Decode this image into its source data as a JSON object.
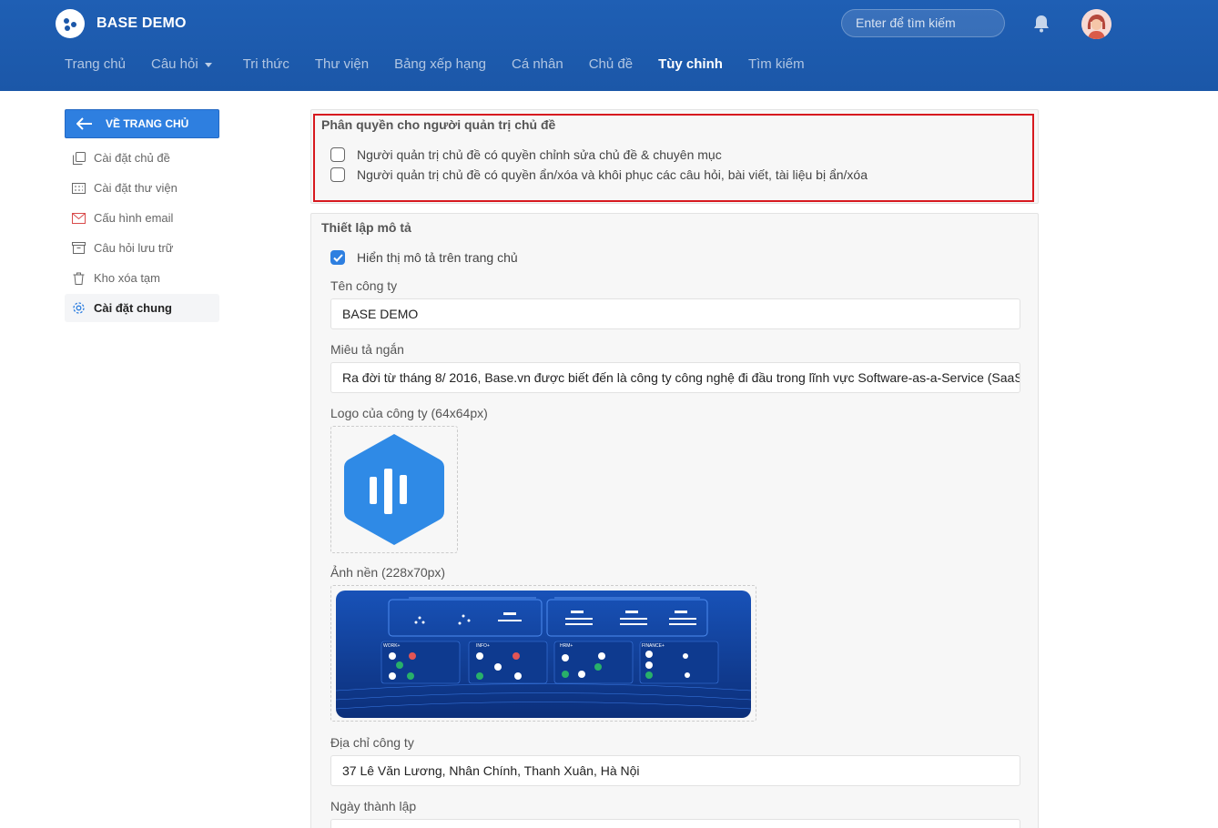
{
  "header": {
    "brand": "BASE DEMO",
    "search_placeholder": "Enter để tìm kiếm",
    "nav": [
      {
        "label": "Trang chủ"
      },
      {
        "label": "Câu hỏi"
      },
      {
        "label": "Tri thức"
      },
      {
        "label": "Thư viện"
      },
      {
        "label": "Bảng xếp hạng"
      },
      {
        "label": "Cá nhân"
      },
      {
        "label": "Chủ đề"
      },
      {
        "label": "Tùy chỉnh"
      },
      {
        "label": "Tìm kiếm"
      }
    ],
    "active_nav": "Tùy chỉnh"
  },
  "sidebar": {
    "back_label": "VỀ TRANG CHỦ",
    "items": [
      {
        "label": "Cài đặt chủ đề",
        "icon": "copy-icon"
      },
      {
        "label": "Cài đặt thư viện",
        "icon": "library-icon"
      },
      {
        "label": "Cấu hình email",
        "icon": "mail-icon"
      },
      {
        "label": "Câu hỏi lưu trữ",
        "icon": "archive-icon"
      },
      {
        "label": "Kho xóa tạm",
        "icon": "trash-icon"
      },
      {
        "label": "Cài đặt chung",
        "icon": "gear-icon"
      }
    ],
    "active_item": "Cài đặt chung"
  },
  "permissions": {
    "title": "Phân quyền cho người quản trị chủ đề",
    "options": [
      {
        "label": "Người quản trị chủ đề có quyền chỉnh sửa chủ đề & chuyên mục",
        "checked": false
      },
      {
        "label": "Người quản trị chủ đề có quyền ẩn/xóa và khôi phục các câu hỏi, bài viết, tài liệu bị ẩn/xóa",
        "checked": false
      }
    ]
  },
  "description": {
    "title": "Thiết lập mô tả",
    "show_on_home_label": "Hiển thị mô tả trên trang chủ",
    "show_on_home_checked": true,
    "company_name_label": "Tên công ty",
    "company_name_value": "BASE DEMO",
    "short_desc_label": "Miêu tả ngắn",
    "short_desc_value": "Ra đời từ tháng 8/ 2016, Base.vn được biết đến là công ty công nghệ đi đầu trong lĩnh vực Software-as-a-Service (SaaS)",
    "logo_label": "Logo của công ty (64x64px)",
    "banner_label": "Ảnh nền (228x70px)",
    "banner_sections": [
      "WORK+",
      "INFO+",
      "HRM+",
      "FINANCE+"
    ],
    "address_label": "Địa chỉ công ty",
    "address_value": "37 Lê Văn Lương, Nhân Chính, Thanh Xuân, Hà Nội",
    "founded_label": "Ngày thành lập"
  },
  "colors": {
    "header_bg": "#1b57a8",
    "primary": "#2e7fe0",
    "highlight_border": "#d7191f"
  }
}
